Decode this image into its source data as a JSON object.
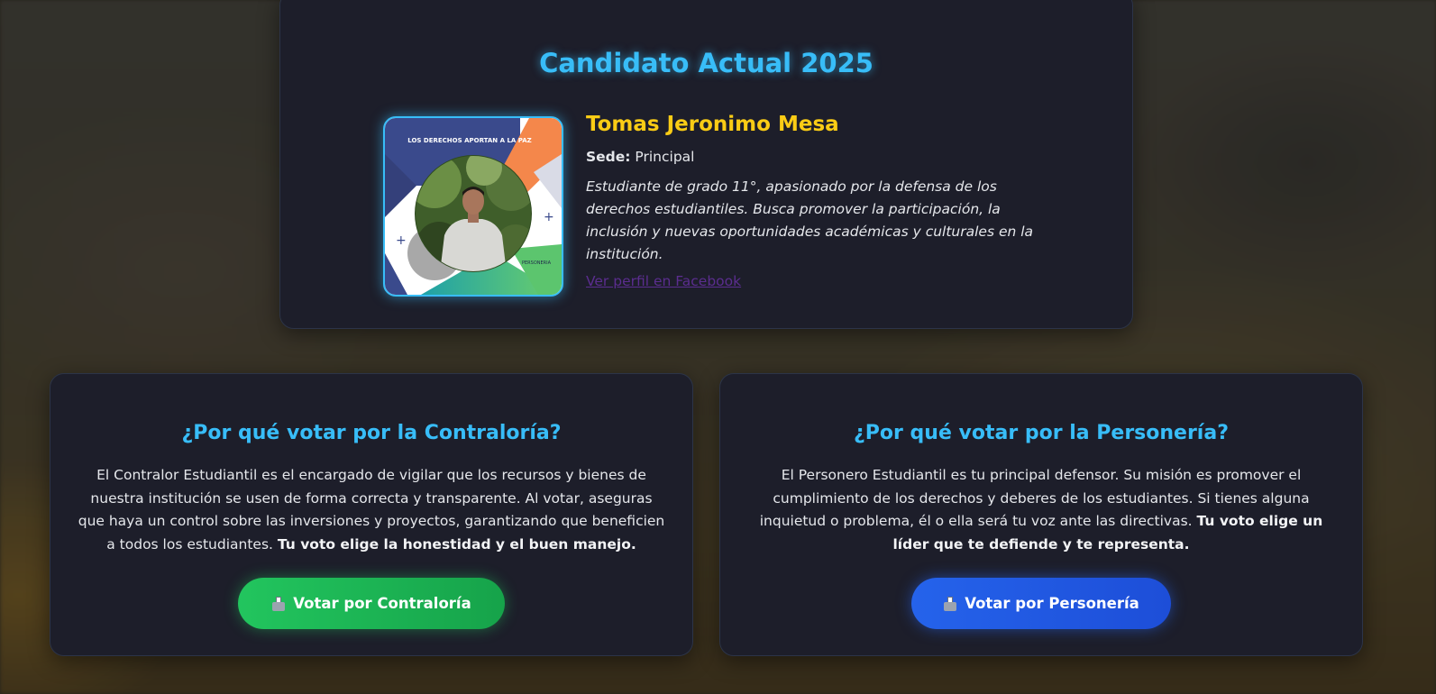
{
  "current_candidate": {
    "section_title": "Candidato Actual 2025",
    "name": "Tomas Jeronimo Mesa",
    "sede_label": "Sede:",
    "sede_value": "Principal",
    "bio": "Estudiante de grado 11°, apasionado por la defensa de los derechos estudiantiles. Busca promover la participación, la inclusión y nuevas oportunidades académicas y culturales en la institución.",
    "facebook_link": "Ver perfil en Facebook",
    "poster": {
      "headline": "LOS DERECHOS APORTAN A LA PAZ",
      "footer_text": "PERSONERIA"
    }
  },
  "contraloria": {
    "title": "¿Por qué votar por la Contraloría?",
    "text": "El Contralor Estudiantil es el encargado de vigilar que los recursos y bienes de nuestra institución se usen de forma correcta y transparente. Al votar, aseguras que haya un control sobre las inversiones y proyectos, garantizando que beneficien a todos los estudiantes.",
    "emphasis": "Tu voto elige la honestidad y el buen manejo.",
    "button_label": "Votar por Contraloría",
    "button_icon": "ballot-box-icon",
    "button_color": "#22c55e"
  },
  "personeria": {
    "title": "¿Por qué votar por la Personería?",
    "text": "El Personero Estudiantil es tu principal defensor. Su misión es promover el cumplimiento de los derechos y deberes de los estudiantes. Si tienes alguna inquietud o problema, él o ella será tu voz ante las directivas.",
    "emphasis": "Tu voto elige un líder que te defiende y te representa.",
    "button_label": "Votar por Personería",
    "button_icon": "ballot-box-icon",
    "button_color": "#2563eb"
  },
  "colors": {
    "accent_title": "#38bdf8",
    "candidate_name": "#facc15",
    "card_background": "#1d1e2a",
    "link": "#5b2d8f"
  }
}
